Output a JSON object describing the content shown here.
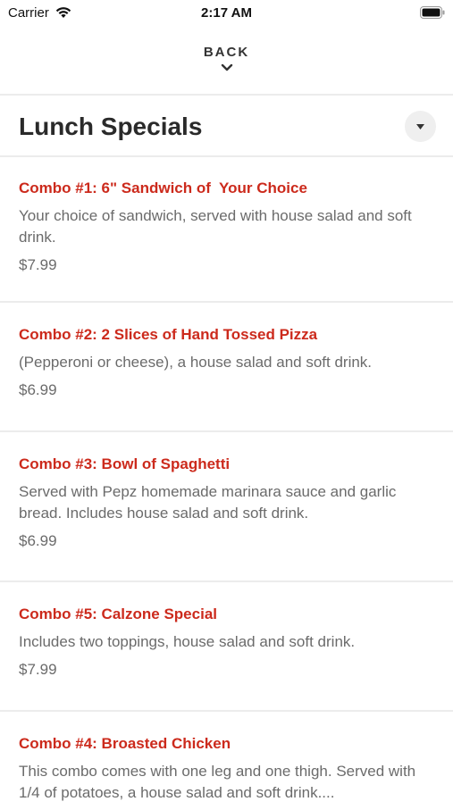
{
  "status_bar": {
    "carrier": "Carrier",
    "time": "2:17 AM",
    "icons": [
      "wifi-icon",
      "battery-icon"
    ]
  },
  "nav": {
    "back_label": "BACK",
    "back_icon": "chevron-down-icon"
  },
  "section": {
    "title": "Lunch Specials",
    "toggle_icon": "triangle-down-icon"
  },
  "colors": {
    "accent_red": "#cc2a1c",
    "text_gray": "#6b6b6b",
    "divider": "#ececec"
  },
  "items": [
    {
      "title": "Combo #1: 6\" Sandwich of  Your Choice",
      "description": "Your choice of sandwich, served with house salad and soft drink.",
      "price": "$7.99"
    },
    {
      "title": "Combo #2: 2 Slices of Hand Tossed Pizza",
      "description": "(Pepperoni or cheese), a house salad and soft drink.",
      "price": "$6.99"
    },
    {
      "title": "Combo #3: Bowl of Spaghetti",
      "description": "Served with Pepz homemade marinara sauce and garlic bread.  Includes house salad and soft drink.",
      "price": "$6.99"
    },
    {
      "title": "Combo #5: Calzone Special",
      "description": "Includes two toppings, house salad and soft drink.",
      "price": "$7.99"
    },
    {
      "title": "Combo #4: Broasted Chicken",
      "description": "This combo comes with one leg and one thigh.  Served with 1/4 of potatoes, a house salad and soft drink....",
      "price": ""
    }
  ]
}
